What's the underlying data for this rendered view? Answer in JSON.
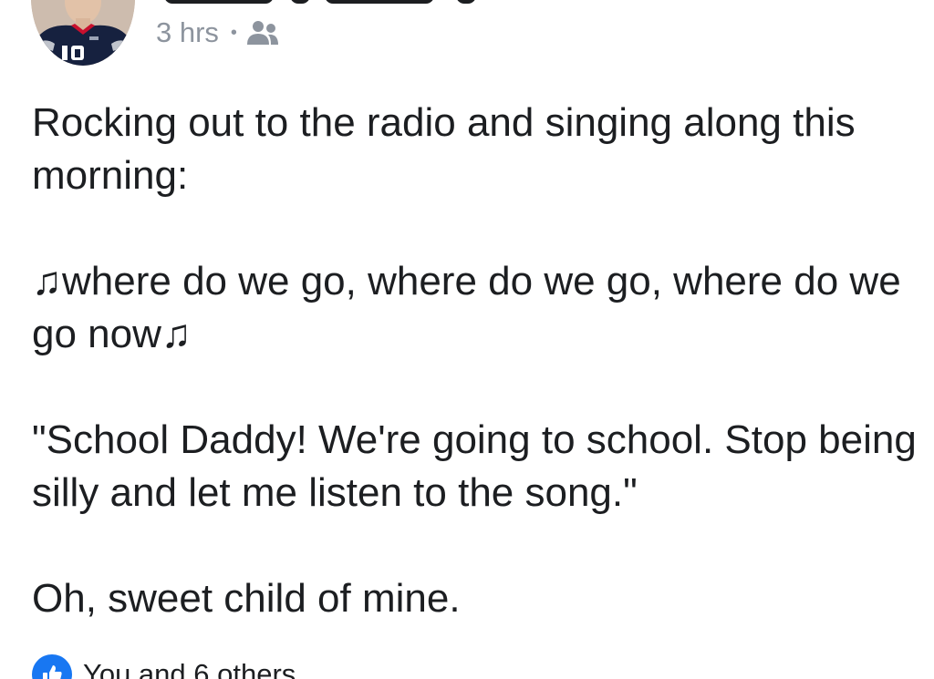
{
  "post": {
    "timestamp": "3 hrs",
    "separator": "•",
    "audience_icon": "friends-icon",
    "paragraphs": [
      "Rocking out to the radio and singing along this morning:",
      "♫where do we go, where do we go, where do we go now♫",
      "\"School Daddy! We're going to school. Stop being silly and let me listen to the song.\"",
      "Oh, sweet child of mine."
    ]
  },
  "reactions": {
    "icon": "like-icon",
    "summary": "You and 6 others"
  },
  "colors": {
    "text": "#1c1e21",
    "meta": "#8d949e",
    "like_blue": "#1877f2"
  }
}
